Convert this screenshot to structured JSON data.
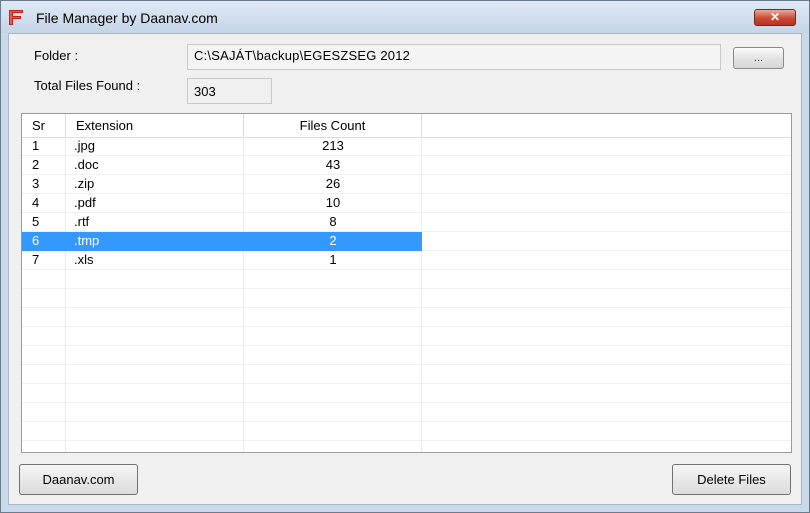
{
  "window": {
    "title": "File Manager by Daanav.com",
    "close_label": "✕",
    "colors": {
      "selection": "#3399ff",
      "close_button": "#c94a35",
      "app_icon": "#c0201a"
    }
  },
  "form": {
    "folder_label": "Folder :",
    "folder_path": "C:\\SAJÁT\\backup\\EGESZSEG 2012",
    "browse_label": "...",
    "total_label": "Total Files Found :",
    "total_value": "303"
  },
  "table": {
    "headers": [
      "Sr",
      "Extension",
      "Files Count",
      ""
    ],
    "rows": [
      {
        "sr": "1",
        "ext": ".jpg",
        "count": "213"
      },
      {
        "sr": "2",
        "ext": ".doc",
        "count": "43"
      },
      {
        "sr": "3",
        "ext": ".zip",
        "count": "26"
      },
      {
        "sr": "4",
        "ext": ".pdf",
        "count": "10"
      },
      {
        "sr": "5",
        "ext": ".rtf",
        "count": "8"
      },
      {
        "sr": "6",
        "ext": ".tmp",
        "count": "2"
      },
      {
        "sr": "7",
        "ext": ".xls",
        "count": "1"
      }
    ],
    "selected_index": 5
  },
  "buttons": {
    "daanav_label": "Daanav.com",
    "delete_label": "Delete Files"
  }
}
